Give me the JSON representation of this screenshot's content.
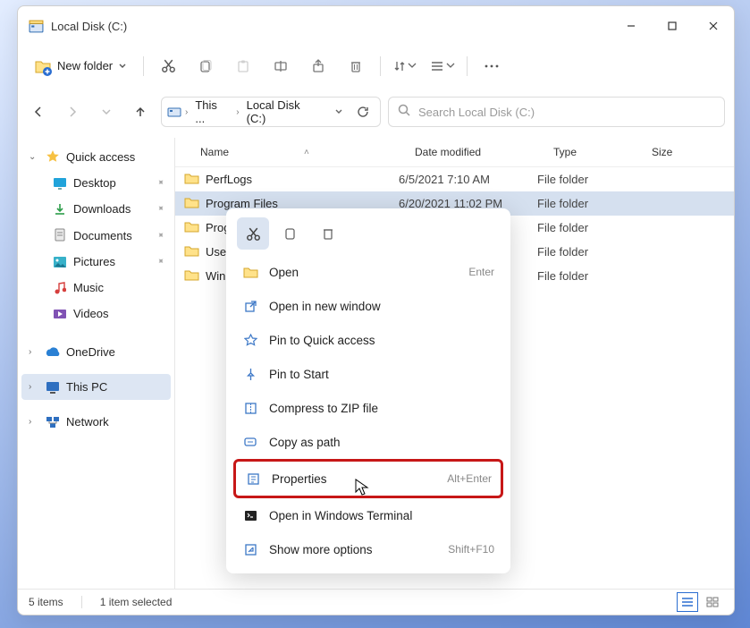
{
  "window": {
    "title": "Local Disk (C:)"
  },
  "toolbar": {
    "new_label": "New folder"
  },
  "breadcrumb": {
    "this_pc": "This ...",
    "current": "Local Disk (C:)"
  },
  "search": {
    "placeholder": "Search Local Disk (C:)"
  },
  "columns": {
    "name": "Name",
    "date": "Date modified",
    "type": "Type",
    "size": "Size"
  },
  "tree": {
    "quick_access": "Quick access",
    "desktop": "Desktop",
    "downloads": "Downloads",
    "documents": "Documents",
    "pictures": "Pictures",
    "music": "Music",
    "videos": "Videos",
    "onedrive": "OneDrive",
    "this_pc": "This PC",
    "network": "Network"
  },
  "files": [
    {
      "name": "PerfLogs",
      "date": "6/5/2021 7:10 AM",
      "type": "File folder",
      "selected": false
    },
    {
      "name": "Program Files",
      "date": "6/20/2021 11:02 PM",
      "type": "File folder",
      "selected": true
    },
    {
      "name": "Prog",
      "date": "",
      "type": "File folder"
    },
    {
      "name": "User",
      "date": "",
      "type": "File folder"
    },
    {
      "name": "Win",
      "date": "",
      "type": "File folder"
    }
  ],
  "ctx": {
    "open": "Open",
    "open_sc": "Enter",
    "open_new_window": "Open in new window",
    "pin_quick": "Pin to Quick access",
    "pin_start": "Pin to Start",
    "compress": "Compress to ZIP file",
    "copy_path": "Copy as path",
    "properties": "Properties",
    "properties_sc": "Alt+Enter",
    "open_terminal": "Open in Windows Terminal",
    "show_more": "Show more options",
    "show_more_sc": "Shift+F10"
  },
  "status": {
    "items": "5 items",
    "selected": "1 item selected"
  }
}
